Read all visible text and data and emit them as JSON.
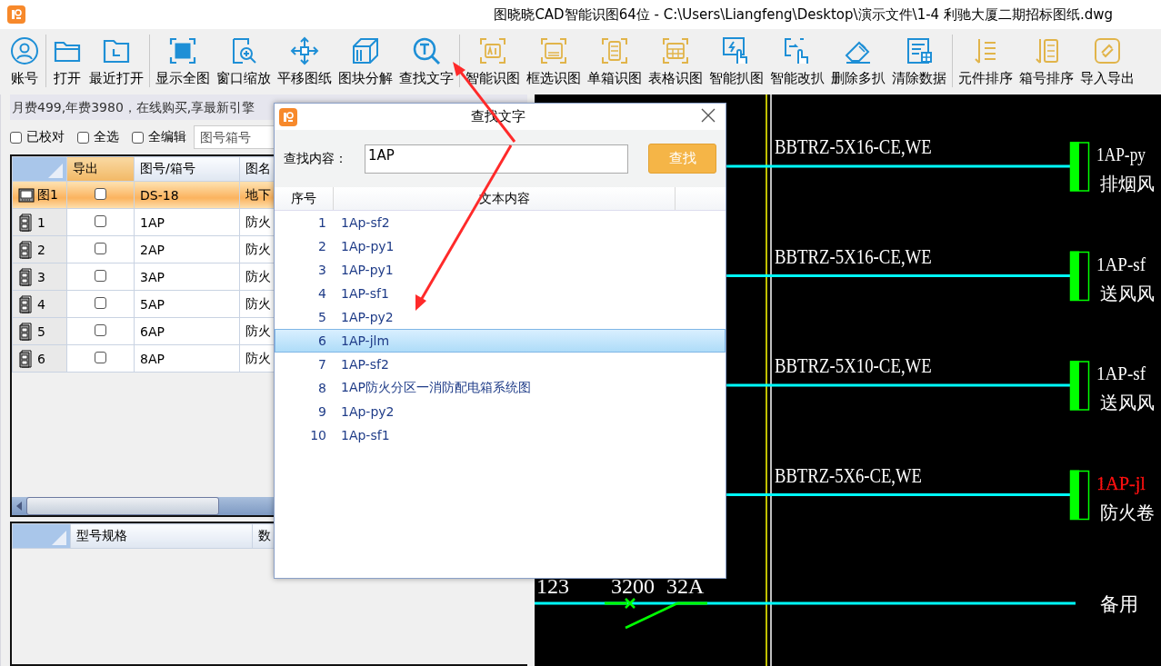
{
  "window": {
    "title": "图晓晓CAD智能识图64位 - C:\\Users\\Liangfeng\\Desktop\\演示文件\\1-4 利驰大厦二期招标图纸.dwg"
  },
  "toolbar": {
    "groups": [
      {
        "items": [
          {
            "label": "账号"
          }
        ]
      },
      {
        "items": [
          {
            "label": "打开"
          },
          {
            "label": "最近打开"
          }
        ]
      },
      {
        "items": [
          {
            "label": "显示全图"
          },
          {
            "label": "窗口缩放"
          },
          {
            "label": "平移图纸"
          },
          {
            "label": "图块分解"
          },
          {
            "label": "查找文字"
          }
        ]
      },
      {
        "items": [
          {
            "label": "智能识图"
          },
          {
            "label": "框选识图"
          },
          {
            "label": "单箱识图"
          },
          {
            "label": "表格识图"
          },
          {
            "label": "智能扒图"
          },
          {
            "label": "智能改扒"
          },
          {
            "label": "删除多扒"
          },
          {
            "label": "清除数据"
          }
        ]
      },
      {
        "items": [
          {
            "label": "元件排序"
          },
          {
            "label": "箱号排序"
          },
          {
            "label": "导入导出"
          }
        ]
      }
    ]
  },
  "side_panel": {
    "promo": "月费499,年费3980，在线购买,享最新引擎",
    "filters": [
      {
        "label": "已校对",
        "checked": false
      },
      {
        "label": "全选",
        "checked": false
      },
      {
        "label": "全编辑",
        "checked": false
      }
    ],
    "search": {
      "placeholder": "图号箱号"
    },
    "table": {
      "columns": [
        {
          "label": "导出",
          "selected": true
        },
        {
          "label": "图号/箱号",
          "selected": false
        },
        {
          "label": "图名",
          "selected": false
        }
      ],
      "rows": [
        {
          "kind": "drawing",
          "header": "图1",
          "export": false,
          "number": "DS-18",
          "name": "地下",
          "selected": true
        },
        {
          "kind": "box",
          "header": "1",
          "export": false,
          "number": "1AP",
          "name": "防火",
          "selected": false
        },
        {
          "kind": "box",
          "header": "2",
          "export": false,
          "number": "2AP",
          "name": "防火",
          "selected": false
        },
        {
          "kind": "box",
          "header": "3",
          "export": false,
          "number": "3AP",
          "name": "防火",
          "selected": false
        },
        {
          "kind": "box",
          "header": "4",
          "export": false,
          "number": "5AP",
          "name": "防火",
          "selected": false
        },
        {
          "kind": "box",
          "header": "5",
          "export": false,
          "number": "6AP",
          "name": "防火",
          "selected": false
        },
        {
          "kind": "box",
          "header": "6",
          "export": false,
          "number": "8AP",
          "name": "防火",
          "selected": false
        }
      ]
    },
    "parts_table": {
      "columns": [
        "型号规格",
        "数"
      ]
    }
  },
  "cad": {
    "circuits": [
      {
        "cable": "BBTRZ-5X16-CE,WE",
        "code": "1AP-py",
        "load": "排烟风",
        "highlighted": false
      },
      {
        "cable": "BBTRZ-5X16-CE,WE",
        "code": "1AP-sf",
        "load": "送风风",
        "highlighted": false
      },
      {
        "cable": "BBTRZ-5X10-CE,WE",
        "code": "1AP-sf",
        "load": "送风风",
        "highlighted": false
      },
      {
        "cable": "BBTRZ-5X6-CE,WE",
        "code": "1AP-jl",
        "load": "防火卷",
        "highlighted": true
      }
    ],
    "spare": {
      "labels": [
        "123",
        "3200",
        "32A"
      ],
      "load": "备用"
    }
  },
  "find_dialog": {
    "title": "查找文字",
    "label": "查找内容：",
    "value": "1AP",
    "button": "查找",
    "columns": [
      "序号",
      "文本内容"
    ],
    "results": [
      {
        "index": "1",
        "text": "1Ap-sf2",
        "selected": false
      },
      {
        "index": "2",
        "text": "1Ap-py1",
        "selected": false
      },
      {
        "index": "3",
        "text": "1AP-py1",
        "selected": false
      },
      {
        "index": "4",
        "text": "1AP-sf1",
        "selected": false
      },
      {
        "index": "5",
        "text": "1AP-py2",
        "selected": false
      },
      {
        "index": "6",
        "text": "1AP-jlm",
        "selected": true
      },
      {
        "index": "7",
        "text": "1AP-sf2",
        "selected": false
      },
      {
        "index": "8",
        "text": "1AP防火分区一消防配电箱系统图",
        "selected": false
      },
      {
        "index": "9",
        "text": "1Ap-py2",
        "selected": false
      },
      {
        "index": "10",
        "text": "1Ap-sf1",
        "selected": false
      }
    ]
  }
}
